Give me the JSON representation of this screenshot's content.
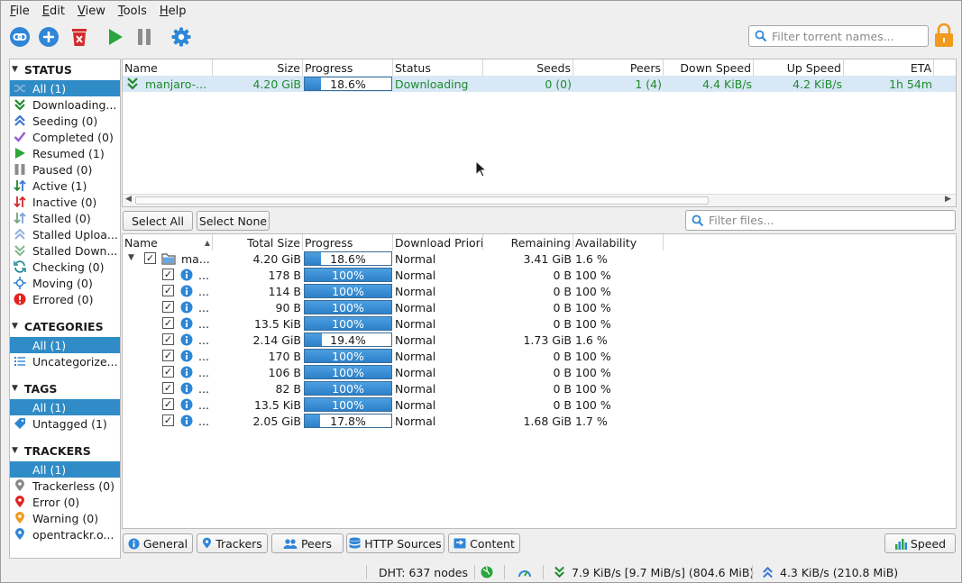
{
  "menu": [
    "File",
    "Edit",
    "View",
    "Tools",
    "Help"
  ],
  "toolbar": {
    "search_placeholder": "Filter torrent names..."
  },
  "sidebar": {
    "status_title": "STATUS",
    "status_items": [
      {
        "label": "All (1)",
        "icon": "shuffle-icon",
        "selected": true
      },
      {
        "label": "Downloading...",
        "icon": "download-icon"
      },
      {
        "label": "Seeding (0)",
        "icon": "upload-icon"
      },
      {
        "label": "Completed (0)",
        "icon": "checkmark-icon"
      },
      {
        "label": "Resumed (1)",
        "icon": "play-icon"
      },
      {
        "label": "Paused (0)",
        "icon": "pause-icon"
      },
      {
        "label": "Active (1)",
        "icon": "active-arrows-icon"
      },
      {
        "label": "Inactive (0)",
        "icon": "inactive-arrows-icon"
      },
      {
        "label": "Stalled (0)",
        "icon": "stalled-arrows-icon"
      },
      {
        "label": "Stalled Uploa...",
        "icon": "stalled-upload-icon"
      },
      {
        "label": "Stalled Down...",
        "icon": "stalled-download-icon"
      },
      {
        "label": "Checking (0)",
        "icon": "refresh-icon"
      },
      {
        "label": "Moving (0)",
        "icon": "move-icon"
      },
      {
        "label": "Errored (0)",
        "icon": "error-icon"
      }
    ],
    "categories_title": "CATEGORIES",
    "category_items": [
      {
        "label": "All (1)",
        "selected": true
      },
      {
        "label": "Uncategorize...",
        "icon": "list-icon"
      }
    ],
    "tags_title": "TAGS",
    "tag_items": [
      {
        "label": "All (1)",
        "selected": true
      },
      {
        "label": "Untagged (1)",
        "icon": "tag-icon"
      }
    ],
    "trackers_title": "TRACKERS",
    "tracker_items": [
      {
        "label": "All (1)",
        "selected": true
      },
      {
        "label": "Trackerless (0)",
        "icon": "pin-gray-icon"
      },
      {
        "label": "Error (0)",
        "icon": "pin-red-icon"
      },
      {
        "label": "Warning (0)",
        "icon": "pin-orange-icon"
      },
      {
        "label": "opentrackr.o...",
        "icon": "pin-blue-icon"
      }
    ]
  },
  "torrents": {
    "columns": [
      "Name",
      "Size",
      "Progress",
      "Status",
      "Seeds",
      "Peers",
      "Down Speed",
      "Up Speed",
      "ETA"
    ],
    "rows": [
      {
        "name": "manjaro-...",
        "size": "4.20 GiB",
        "progress": 0.186,
        "progress_label": "18.6%",
        "status": "Downloading",
        "seeds": "0 (0)",
        "peers": "1 (4)",
        "down": "4.4 KiB/s",
        "up": "4.2 KiB/s",
        "eta": "1h 54m"
      }
    ]
  },
  "content": {
    "select_all": "Select All",
    "select_none": "Select None",
    "filter_placeholder": "Filter files...",
    "columns": [
      "Name",
      "Total Size",
      "Progress",
      "Download Priori",
      "Remaining",
      "Availability"
    ],
    "folder": {
      "name": "ma...",
      "size": "4.20 GiB",
      "progress": 0.186,
      "progress_label": "18.6%",
      "priority": "Normal",
      "remaining": "3.41 GiB",
      "availability": "1.6 %"
    },
    "files": [
      {
        "name": "...",
        "size": "178 B",
        "progress": 1.0,
        "progress_label": "100%",
        "priority": "Normal",
        "remaining": "0 B",
        "availability": "100 %"
      },
      {
        "name": "...",
        "size": "114 B",
        "progress": 1.0,
        "progress_label": "100%",
        "priority": "Normal",
        "remaining": "0 B",
        "availability": "100 %"
      },
      {
        "name": "...",
        "size": "90 B",
        "progress": 1.0,
        "progress_label": "100%",
        "priority": "Normal",
        "remaining": "0 B",
        "availability": "100 %"
      },
      {
        "name": "...",
        "size": "13.5 KiB",
        "progress": 1.0,
        "progress_label": "100%",
        "priority": "Normal",
        "remaining": "0 B",
        "availability": "100 %"
      },
      {
        "name": "...",
        "size": "2.14 GiB",
        "progress": 0.194,
        "progress_label": "19.4%",
        "priority": "Normal",
        "remaining": "1.73 GiB",
        "availability": "1.6 %"
      },
      {
        "name": "...",
        "size": "170 B",
        "progress": 1.0,
        "progress_label": "100%",
        "priority": "Normal",
        "remaining": "0 B",
        "availability": "100 %"
      },
      {
        "name": "...",
        "size": "106 B",
        "progress": 1.0,
        "progress_label": "100%",
        "priority": "Normal",
        "remaining": "0 B",
        "availability": "100 %"
      },
      {
        "name": "...",
        "size": "82 B",
        "progress": 1.0,
        "progress_label": "100%",
        "priority": "Normal",
        "remaining": "0 B",
        "availability": "100 %"
      },
      {
        "name": "...",
        "size": "13.5 KiB",
        "progress": 1.0,
        "progress_label": "100%",
        "priority": "Normal",
        "remaining": "0 B",
        "availability": "100 %"
      },
      {
        "name": "...",
        "size": "2.05 GiB",
        "progress": 0.178,
        "progress_label": "17.8%",
        "priority": "Normal",
        "remaining": "1.68 GiB",
        "availability": "1.7 %"
      }
    ]
  },
  "tabs": [
    "General",
    "Trackers",
    "Peers",
    "HTTP Sources",
    "Content"
  ],
  "speed_button": "Speed",
  "statusbar": {
    "dht": "DHT: 637 nodes",
    "download": "7.9 KiB/s [9.7 MiB/s] (804.6 MiB)",
    "upload": "4.3 KiB/s (210.8 MiB)"
  },
  "colors": {
    "selection": "#308cc6",
    "progress_fill": "#2c80c9",
    "downloading": "#1f8a2c"
  }
}
